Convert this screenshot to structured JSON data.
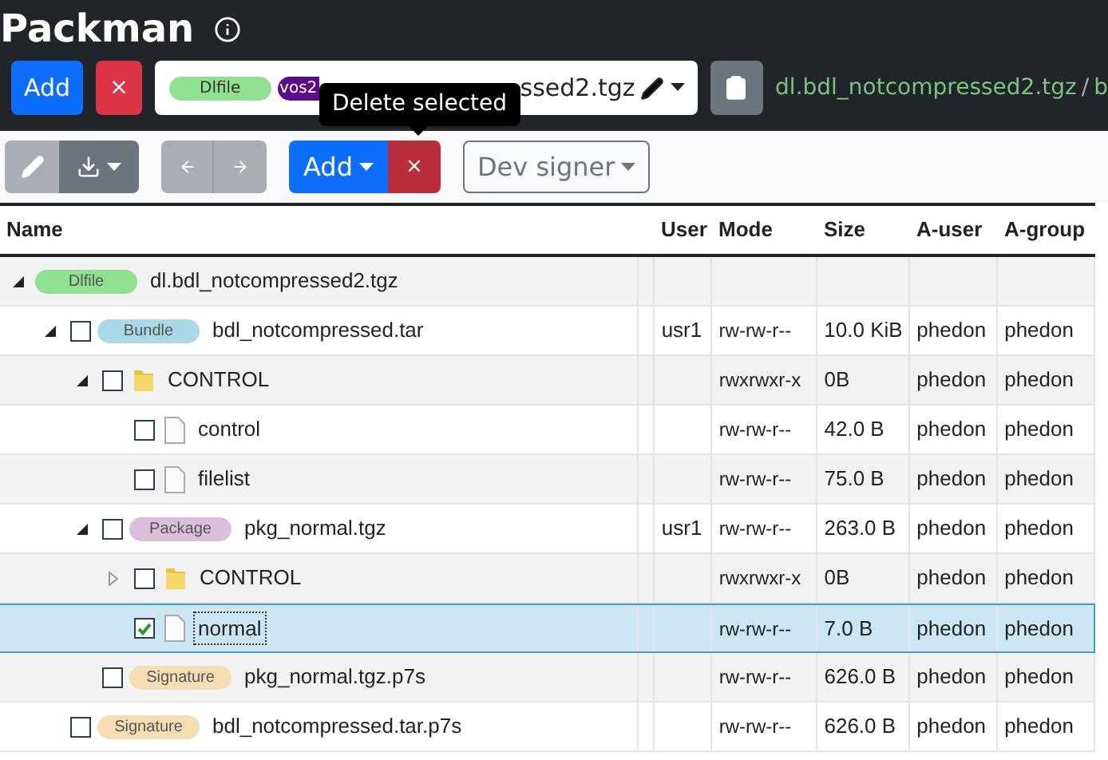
{
  "app": {
    "title": "Packman"
  },
  "top_bar": {
    "add_button": "Add",
    "remove_button": "×",
    "selector": {
      "badges": [
        {
          "label": "Dlfile",
          "color": "#8fe08f"
        },
        {
          "label": "vos2",
          "color": "#5a0e8c"
        }
      ],
      "value": "ssed2.tgz"
    },
    "breadcrumb": [
      {
        "label": "dl.bdl_notcompressed2.tgz"
      },
      {
        "label": "b"
      }
    ],
    "separator": "/"
  },
  "tooltip": {
    "text": "Delete selected"
  },
  "toolbar": {
    "add_button": "Add",
    "remove_button": "×",
    "signer": {
      "value": "Dev signer"
    }
  },
  "table": {
    "columns": [
      "Name",
      "User",
      "Mode",
      "Size",
      "A-user",
      "A-group"
    ],
    "rows": [
      {
        "kind": "badge",
        "badge": "Dlfile",
        "color": "#8fe08f",
        "name": "dl.bdl_notcompressed2.tgz",
        "expanded": true,
        "selected": false,
        "children": [
          {
            "kind": "badge",
            "badge": "Bundle",
            "color": "#a9d8e6",
            "name": "bdl_notcompressed.tar",
            "checked": false,
            "expanded": true,
            "selected": false,
            "user": "usr1",
            "mode": "rw-rw-r--",
            "size": "10.0 KiB",
            "a_user": "phedon",
            "a_group": "phedon",
            "children": [
              {
                "kind": "folder",
                "name": "CONTROL",
                "checked": false,
                "expanded": true,
                "selected": false,
                "mode": "rwxrwxr-x",
                "size": "0B",
                "a_user": "phedon",
                "a_group": "phedon",
                "children": [
                  {
                    "kind": "file",
                    "name": "control",
                    "checked": false,
                    "selected": false,
                    "mode": "rw-rw-r--",
                    "size": "42.0 B",
                    "a_user": "phedon",
                    "a_group": "phedon"
                  },
                  {
                    "kind": "file",
                    "name": "filelist",
                    "checked": false,
                    "selected": false,
                    "mode": "rw-rw-r--",
                    "size": "75.0 B",
                    "a_user": "phedon",
                    "a_group": "phedon"
                  }
                ]
              },
              {
                "kind": "badge",
                "badge": "Package",
                "color": "#d9bfd9",
                "name": "pkg_normal.tgz",
                "checked": false,
                "expanded": true,
                "selected": false,
                "user": "usr1",
                "mode": "rw-rw-r--",
                "size": "263.0 B",
                "a_user": "phedon",
                "a_group": "phedon",
                "children": [
                  {
                    "kind": "folder",
                    "name": "CONTROL",
                    "checked": false,
                    "expanded": false,
                    "selected": false,
                    "mode": "rwxrwxr-x",
                    "size": "0B",
                    "a_user": "phedon",
                    "a_group": "phedon"
                  },
                  {
                    "kind": "file",
                    "name": "normal",
                    "checked": true,
                    "selected": true,
                    "mode": "rw-rw-r--",
                    "size": "7.0 B",
                    "a_user": "phedon",
                    "a_group": "phedon"
                  }
                ]
              },
              {
                "kind": "badge",
                "badge": "Signature",
                "color": "#f5deb3",
                "name": "pkg_normal.tgz.p7s",
                "checked": false,
                "selected": false,
                "mode": "rw-rw-r--",
                "size": "626.0 B",
                "a_user": "phedon",
                "a_group": "phedon"
              }
            ]
          },
          {
            "kind": "badge",
            "badge": "Signature",
            "color": "#f5deb3",
            "name": "bdl_notcompressed.tar.p7s",
            "checked": false,
            "selected": false,
            "mode": "rw-rw-r--",
            "size": "626.0 B",
            "a_user": "phedon",
            "a_group": "phedon"
          }
        ]
      }
    ]
  }
}
